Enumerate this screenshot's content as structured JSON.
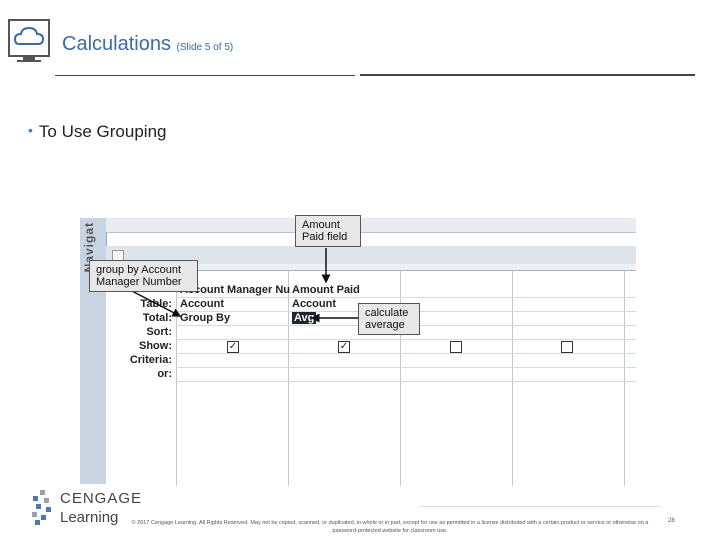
{
  "header": {
    "title": "Calculations",
    "subtitle": "(Slide 5 of 5)",
    "logo_icon": "cloud-computer-icon"
  },
  "bullet": {
    "text": "To Use Grouping"
  },
  "screenshot": {
    "nav_label": "Navigat",
    "row_labels": [
      "Table:",
      "Total:",
      "Sort:",
      "Show:",
      "Criteria:",
      "or:"
    ],
    "columns": [
      {
        "field": "Account Manager Nu",
        "table": "Account",
        "total": "Group By",
        "show": true
      },
      {
        "field": "Amount Paid",
        "table": "Account",
        "total": "Avg",
        "show": true
      },
      {
        "field": "",
        "table": "",
        "total": "",
        "show": false
      },
      {
        "field": "",
        "table": "",
        "total": "",
        "show": false
      }
    ],
    "callouts": {
      "amount_paid": "Amount Paid field",
      "group_by": "group by Account Manager Number",
      "calculate": "calculate average"
    }
  },
  "footer": {
    "brand_line1": "CENGAGE",
    "brand_line2": "Learning",
    "copyright": "© 2017 Cengage Learning. All Rights Reserved. May not be copied, scanned, or duplicated, in whole or in part, except for use as permitted in a license distributed with a certain product or service or otherwise on a password-protected website for classroom use.",
    "page_number": "28"
  },
  "colors": {
    "title": "#3b6aa8",
    "bullet": "#4a78b5",
    "callout_bg": "#e8e8e8"
  }
}
